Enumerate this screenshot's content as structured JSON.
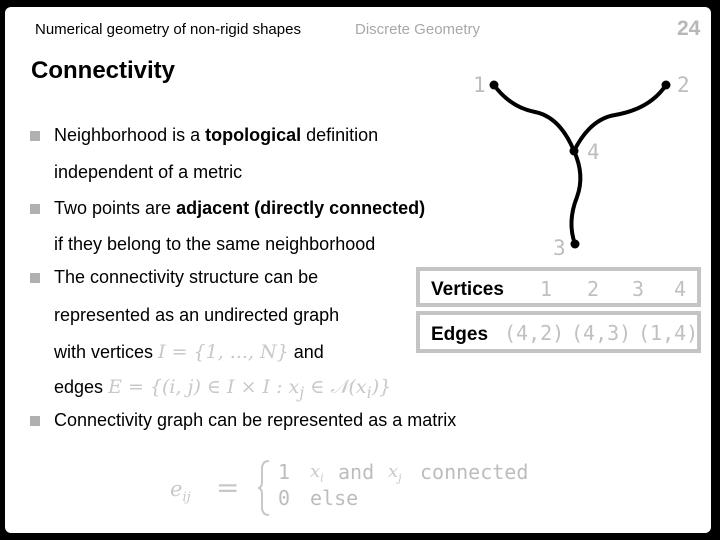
{
  "header": {
    "course_title": "Numerical geometry of non-rigid shapes",
    "section": "Discrete Geometry",
    "page_number": "24"
  },
  "slide": {
    "title": "Connectivity",
    "bullets": [
      {
        "line1_pre": "Neighborhood is a ",
        "line1_bold": "topological",
        "line1_post": " definition",
        "line2": "independent of a metric"
      },
      {
        "line1_pre": "Two points are ",
        "line1_bold": "adjacent (directly connected)",
        "line2": "if they belong to the same neighborhood"
      },
      {
        "line1": "The connectivity structure can be",
        "line2": "represented as an undirected graph",
        "line3_pre": "with vertices",
        "line3_math": "I = {1, ..., N}",
        "line3_post": "and",
        "line4_pre": "edges",
        "line4_math": "E = {(i, j) ∈ I × I : x",
        "line4_math_sub": "j",
        "line4_math_tail": " ∈ 𝒩(x",
        "line4_math_sub2": "i",
        "line4_math_end": ")}"
      },
      {
        "line1": "Connectivity graph can be represented as a matrix"
      }
    ],
    "matrix_formula": {
      "lhs": "e",
      "lhs_sub": "ij",
      "equals": "=",
      "case1_value": "1",
      "case1_x1": "x",
      "case1_x1_sub": "i",
      "case1_and": "and",
      "case1_x2": "x",
      "case1_x2_sub": "j",
      "case1_cond": "connected",
      "case2_value": "0",
      "case2_cond": "else"
    }
  },
  "graph": {
    "node_labels": [
      "1",
      "2",
      "3",
      "4"
    ],
    "edges": [
      [
        "4",
        "2"
      ],
      [
        "4",
        "3"
      ],
      [
        "1",
        "4"
      ]
    ]
  },
  "table": {
    "vertices_label": "Vertices",
    "vertices": [
      "1",
      "2",
      "3",
      "4"
    ],
    "edges_label": "Edges",
    "edges": [
      "(4,2)",
      "(4,3)",
      "(1,4)"
    ]
  }
}
